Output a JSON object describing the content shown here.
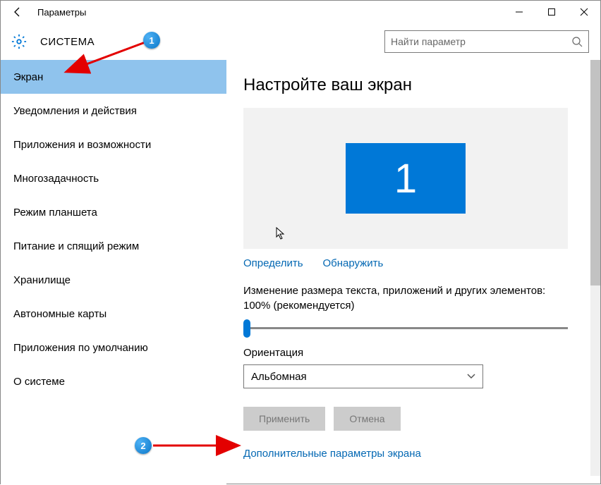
{
  "titlebar": {
    "title": "Параметры"
  },
  "header": {
    "section": "СИСТЕМА",
    "search_placeholder": "Найти параметр"
  },
  "sidebar": {
    "items": [
      {
        "label": "Экран",
        "selected": true
      },
      {
        "label": "Уведомления и действия"
      },
      {
        "label": "Приложения и возможности"
      },
      {
        "label": "Многозадачность"
      },
      {
        "label": "Режим планшета"
      },
      {
        "label": "Питание и спящий режим"
      },
      {
        "label": "Хранилище"
      },
      {
        "label": "Автономные карты"
      },
      {
        "label": "Приложения по умолчанию"
      },
      {
        "label": "О системе"
      }
    ]
  },
  "main": {
    "heading": "Настройте ваш экран",
    "monitor_number": "1",
    "identify": "Определить",
    "detect": "Обнаружить",
    "scale_label": "Изменение размера текста, приложений и других элементов: 100% (рекомендуется)",
    "orientation_label": "Ориентация",
    "orientation_value": "Альбомная",
    "apply": "Применить",
    "cancel": "Отмена",
    "advanced_link": "Дополнительные параметры экрана"
  },
  "annotations": {
    "badge1": "1",
    "badge2": "2"
  }
}
